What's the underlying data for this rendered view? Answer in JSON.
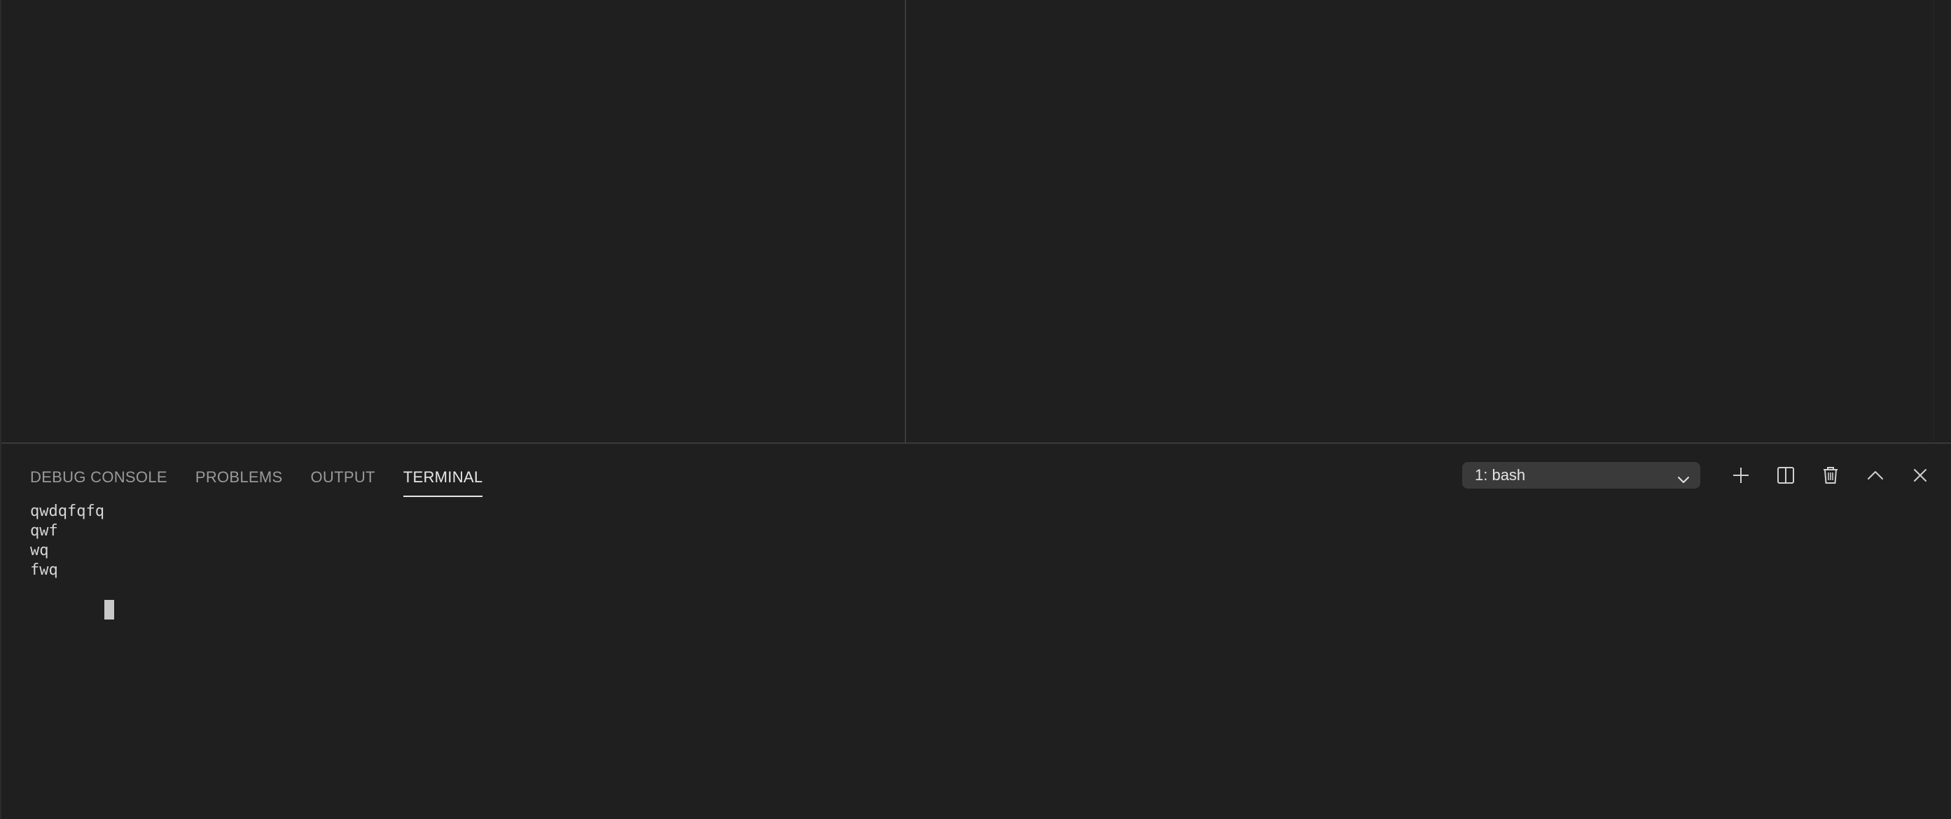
{
  "panel": {
    "tabs": [
      {
        "label": "DEBUG CONSOLE",
        "active": false
      },
      {
        "label": "PROBLEMS",
        "active": false
      },
      {
        "label": "OUTPUT",
        "active": false
      },
      {
        "label": "TERMINAL",
        "active": true
      }
    ],
    "terminal_selector": {
      "selected": "1: bash",
      "icon": "chevron-down-icon"
    },
    "actions": [
      {
        "name": "new-terminal",
        "icon": "plus-icon"
      },
      {
        "name": "split-terminal",
        "icon": "split-icon"
      },
      {
        "name": "kill-terminal",
        "icon": "trash-icon"
      },
      {
        "name": "maximize-panel",
        "icon": "chevron-up-icon"
      },
      {
        "name": "close-panel",
        "icon": "close-icon"
      }
    ]
  },
  "terminal": {
    "lines": [
      "qwdqfqfq",
      "qwf",
      "wq",
      "fwq"
    ]
  },
  "colors": {
    "background": "#1f1f1f",
    "text": "#d6d6d6",
    "tab_inactive": "#9a9a9a",
    "tab_active": "#e7e7e7",
    "select_bg": "#3a3a3a"
  }
}
